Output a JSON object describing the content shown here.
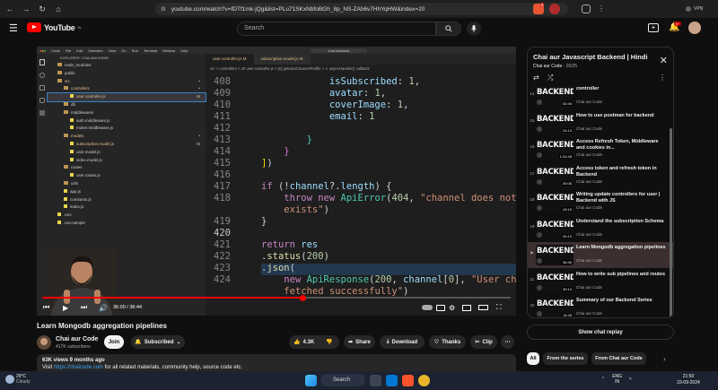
{
  "browser": {
    "url": "youtube.com/watch?v=fDTf1mk-jQg&list=PLu71SKxNbfoBGh_8p_NS-ZAh6v7HhYqHW&index=20",
    "vpn_label": "VPN",
    "badge_count": "9"
  },
  "header": {
    "logo_text": "YouTube",
    "logo_region": "IN",
    "search_placeholder": "Search",
    "notif_count": "9+"
  },
  "editor": {
    "window_title": "chai-backend",
    "menu": [
      "Code",
      "File",
      "Edit",
      "Selection",
      "View",
      "Go",
      "Run",
      "Terminal",
      "Window",
      "Help"
    ],
    "explorer_header": "EXPLORER: CHAI-BACKEND",
    "tree": [
      {
        "label": "node_modules",
        "indent": 1,
        "type": "folder"
      },
      {
        "label": "public",
        "indent": 1,
        "type": "folder"
      },
      {
        "label": "src",
        "indent": 1,
        "type": "folder",
        "mark": "•"
      },
      {
        "label": "controllers",
        "indent": 2,
        "type": "folder",
        "mark": "•"
      },
      {
        "label": "user.controller.js",
        "indent": 3,
        "type": "file",
        "mark": "M",
        "selected": true
      },
      {
        "label": "db",
        "indent": 2,
        "type": "folder"
      },
      {
        "label": "middlewares",
        "indent": 2,
        "type": "folder"
      },
      {
        "label": "auth.middleware.js",
        "indent": 3,
        "type": "file"
      },
      {
        "label": "multer.middleware.js",
        "indent": 3,
        "type": "file"
      },
      {
        "label": "models",
        "indent": 2,
        "type": "folder",
        "mark": "•"
      },
      {
        "label": "subscription.model.js",
        "indent": 3,
        "type": "file",
        "mark": "M"
      },
      {
        "label": "user.model.js",
        "indent": 3,
        "type": "file"
      },
      {
        "label": "video.model.js",
        "indent": 3,
        "type": "file"
      },
      {
        "label": "routes",
        "indent": 2,
        "type": "folder"
      },
      {
        "label": "user.routes.js",
        "indent": 3,
        "type": "file"
      },
      {
        "label": "utils",
        "indent": 2,
        "type": "folder"
      },
      {
        "label": "app.js",
        "indent": 2,
        "type": "file"
      },
      {
        "label": "constants.js",
        "indent": 2,
        "type": "file"
      },
      {
        "label": "index.js",
        "indent": 2,
        "type": "file"
      },
      {
        "label": ".env",
        "indent": 1,
        "type": "file"
      },
      {
        "label": ".env.sample",
        "indent": 1,
        "type": "file"
      }
    ],
    "tabs": [
      "user.controller.js M",
      "subscription.model.js M"
    ],
    "breadcrumb": "src  >  controllers  >  JS user.controller.js  >  [e] getUserChannelProfile  >  ⊙ asyncHandler() callback",
    "line_numbers": [
      "408",
      "409",
      "410",
      "411",
      "412",
      "413",
      "414",
      "415",
      "416",
      "417",
      "418",
      "",
      "419",
      "420",
      "421",
      "422",
      "423",
      "424",
      ""
    ]
  },
  "player": {
    "time": "36:00 / 36:44",
    "progress": 0.556
  },
  "video": {
    "title": "Learn Mongodb aggregation pipelines",
    "channel": "Chai aur Code",
    "subscribers": "417K subscribers",
    "join_label": "Join",
    "subscribe_label": "Subscribed",
    "likes": "4.3K",
    "share_label": "Share",
    "download_label": "Download",
    "thanks_label": "Thanks",
    "clip_label": "Clip",
    "views_line": "63K views  9 months ago",
    "desc_prefix": "Visit ",
    "desc_link": "https://chaicode.com",
    "desc_suffix": " for all related materials, community help, source code etc."
  },
  "playlist": {
    "title": "Chai aur Javascript Backend | Hindi",
    "owner": "Chai aur Code",
    "position": "20/25",
    "thumb_text": "BACKEND",
    "items": [
      {
        "idx": "14",
        "title": "controller",
        "channel": "Chai aur Code",
        "dur": "52:45",
        "current": false
      },
      {
        "idx": "15",
        "title": "How to use postman for backend",
        "channel": "Chai aur Code",
        "dur": "24:13",
        "current": false
      },
      {
        "idx": "16",
        "title": "Access Refresh Token, Middleware and cookies in...",
        "channel": "Chai aur Code",
        "dur": "1:02:45",
        "current": false
      },
      {
        "idx": "17",
        "title": "Access token and refresh token in Backend",
        "channel": "Chai aur Code",
        "dur": "30:08",
        "current": false
      },
      {
        "idx": "18",
        "title": "Writing update controllers for user | Backend with JS",
        "channel": "Chai aur Code",
        "dur": "43:15",
        "current": false
      },
      {
        "idx": "19",
        "title": "Understand the subscription Schema",
        "channel": "Chai aur Code",
        "dur": "20:13",
        "current": false
      },
      {
        "idx": "▶",
        "title": "Learn Mongodb aggregation pipelines",
        "channel": "Chai aur Code",
        "dur": "36:45",
        "current": true
      },
      {
        "idx": "21",
        "title": "How to write sub pipelines and routes",
        "channel": "Chai aur Code",
        "dur": "30:14",
        "current": false
      },
      {
        "idx": "22",
        "title": "Summary of our Backend Series",
        "channel": "Chai aur Code",
        "dur": "15:45",
        "current": false
      }
    ]
  },
  "chat_replay_label": "Show chat replay",
  "chips": [
    "All",
    "From the series",
    "From Chai aur Code"
  ],
  "taskbar": {
    "temp": "29°C",
    "weather": "Cloudy",
    "search": "Search",
    "lang1": "ENG",
    "lang2": "IN",
    "time": "21:50",
    "date": "23-09-2024"
  },
  "colors": {
    "accent": "#ff0000",
    "link": "#3ea6ff",
    "bg": "#0f0f0f"
  }
}
